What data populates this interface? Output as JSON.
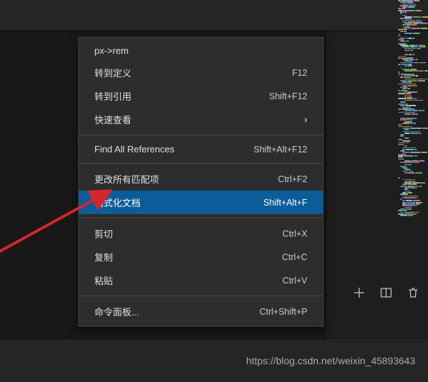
{
  "context_menu": {
    "groups": [
      [
        {
          "label": "px->rem",
          "shortcut": "",
          "sub": false,
          "hl": false
        },
        {
          "label": "转到定义",
          "shortcut": "F12",
          "sub": false,
          "hl": false
        },
        {
          "label": "转到引用",
          "shortcut": "Shift+F12",
          "sub": false,
          "hl": false
        },
        {
          "label": "快速查看",
          "shortcut": "",
          "sub": true,
          "hl": false
        }
      ],
      [
        {
          "label": "Find All References",
          "shortcut": "Shift+Alt+F12",
          "sub": false,
          "hl": false
        }
      ],
      [
        {
          "label": "更改所有匹配项",
          "shortcut": "Ctrl+F2",
          "sub": false,
          "hl": false
        },
        {
          "label": "格式化文档",
          "shortcut": "Shift+Alt+F",
          "sub": false,
          "hl": true
        }
      ],
      [
        {
          "label": "剪切",
          "shortcut": "Ctrl+X",
          "sub": false,
          "hl": false
        },
        {
          "label": "复制",
          "shortcut": "Ctrl+C",
          "sub": false,
          "hl": false
        },
        {
          "label": "粘贴",
          "shortcut": "Ctrl+V",
          "sub": false,
          "hl": false
        }
      ],
      [
        {
          "label": "命令面板...",
          "shortcut": "Ctrl+Shift+P",
          "sub": false,
          "hl": false
        }
      ]
    ]
  },
  "watermark": "https://blog.csdn.net/weixin_45893643",
  "action_icons": {
    "add": "add-icon",
    "split": "split-editor-icon",
    "trash": "trash-icon"
  }
}
